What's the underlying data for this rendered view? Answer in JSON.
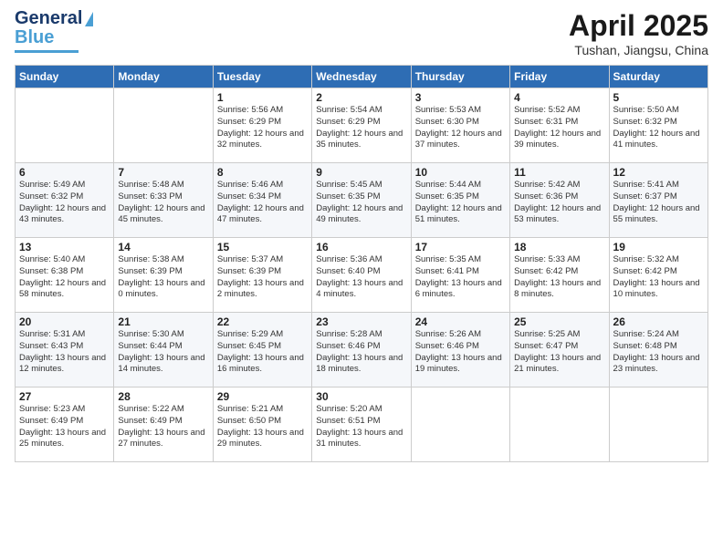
{
  "logo": {
    "line1": "General",
    "line2": "Blue"
  },
  "header": {
    "title": "April 2025",
    "subtitle": "Tushan, Jiangsu, China"
  },
  "weekdays": [
    "Sunday",
    "Monday",
    "Tuesday",
    "Wednesday",
    "Thursday",
    "Friday",
    "Saturday"
  ],
  "weeks": [
    [
      {
        "day": "",
        "sunrise": "",
        "sunset": "",
        "daylight": ""
      },
      {
        "day": "",
        "sunrise": "",
        "sunset": "",
        "daylight": ""
      },
      {
        "day": "1",
        "sunrise": "Sunrise: 5:56 AM",
        "sunset": "Sunset: 6:29 PM",
        "daylight": "Daylight: 12 hours and 32 minutes."
      },
      {
        "day": "2",
        "sunrise": "Sunrise: 5:54 AM",
        "sunset": "Sunset: 6:29 PM",
        "daylight": "Daylight: 12 hours and 35 minutes."
      },
      {
        "day": "3",
        "sunrise": "Sunrise: 5:53 AM",
        "sunset": "Sunset: 6:30 PM",
        "daylight": "Daylight: 12 hours and 37 minutes."
      },
      {
        "day": "4",
        "sunrise": "Sunrise: 5:52 AM",
        "sunset": "Sunset: 6:31 PM",
        "daylight": "Daylight: 12 hours and 39 minutes."
      },
      {
        "day": "5",
        "sunrise": "Sunrise: 5:50 AM",
        "sunset": "Sunset: 6:32 PM",
        "daylight": "Daylight: 12 hours and 41 minutes."
      }
    ],
    [
      {
        "day": "6",
        "sunrise": "Sunrise: 5:49 AM",
        "sunset": "Sunset: 6:32 PM",
        "daylight": "Daylight: 12 hours and 43 minutes."
      },
      {
        "day": "7",
        "sunrise": "Sunrise: 5:48 AM",
        "sunset": "Sunset: 6:33 PM",
        "daylight": "Daylight: 12 hours and 45 minutes."
      },
      {
        "day": "8",
        "sunrise": "Sunrise: 5:46 AM",
        "sunset": "Sunset: 6:34 PM",
        "daylight": "Daylight: 12 hours and 47 minutes."
      },
      {
        "day": "9",
        "sunrise": "Sunrise: 5:45 AM",
        "sunset": "Sunset: 6:35 PM",
        "daylight": "Daylight: 12 hours and 49 minutes."
      },
      {
        "day": "10",
        "sunrise": "Sunrise: 5:44 AM",
        "sunset": "Sunset: 6:35 PM",
        "daylight": "Daylight: 12 hours and 51 minutes."
      },
      {
        "day": "11",
        "sunrise": "Sunrise: 5:42 AM",
        "sunset": "Sunset: 6:36 PM",
        "daylight": "Daylight: 12 hours and 53 minutes."
      },
      {
        "day": "12",
        "sunrise": "Sunrise: 5:41 AM",
        "sunset": "Sunset: 6:37 PM",
        "daylight": "Daylight: 12 hours and 55 minutes."
      }
    ],
    [
      {
        "day": "13",
        "sunrise": "Sunrise: 5:40 AM",
        "sunset": "Sunset: 6:38 PM",
        "daylight": "Daylight: 12 hours and 58 minutes."
      },
      {
        "day": "14",
        "sunrise": "Sunrise: 5:38 AM",
        "sunset": "Sunset: 6:39 PM",
        "daylight": "Daylight: 13 hours and 0 minutes."
      },
      {
        "day": "15",
        "sunrise": "Sunrise: 5:37 AM",
        "sunset": "Sunset: 6:39 PM",
        "daylight": "Daylight: 13 hours and 2 minutes."
      },
      {
        "day": "16",
        "sunrise": "Sunrise: 5:36 AM",
        "sunset": "Sunset: 6:40 PM",
        "daylight": "Daylight: 13 hours and 4 minutes."
      },
      {
        "day": "17",
        "sunrise": "Sunrise: 5:35 AM",
        "sunset": "Sunset: 6:41 PM",
        "daylight": "Daylight: 13 hours and 6 minutes."
      },
      {
        "day": "18",
        "sunrise": "Sunrise: 5:33 AM",
        "sunset": "Sunset: 6:42 PM",
        "daylight": "Daylight: 13 hours and 8 minutes."
      },
      {
        "day": "19",
        "sunrise": "Sunrise: 5:32 AM",
        "sunset": "Sunset: 6:42 PM",
        "daylight": "Daylight: 13 hours and 10 minutes."
      }
    ],
    [
      {
        "day": "20",
        "sunrise": "Sunrise: 5:31 AM",
        "sunset": "Sunset: 6:43 PM",
        "daylight": "Daylight: 13 hours and 12 minutes."
      },
      {
        "day": "21",
        "sunrise": "Sunrise: 5:30 AM",
        "sunset": "Sunset: 6:44 PM",
        "daylight": "Daylight: 13 hours and 14 minutes."
      },
      {
        "day": "22",
        "sunrise": "Sunrise: 5:29 AM",
        "sunset": "Sunset: 6:45 PM",
        "daylight": "Daylight: 13 hours and 16 minutes."
      },
      {
        "day": "23",
        "sunrise": "Sunrise: 5:28 AM",
        "sunset": "Sunset: 6:46 PM",
        "daylight": "Daylight: 13 hours and 18 minutes."
      },
      {
        "day": "24",
        "sunrise": "Sunrise: 5:26 AM",
        "sunset": "Sunset: 6:46 PM",
        "daylight": "Daylight: 13 hours and 19 minutes."
      },
      {
        "day": "25",
        "sunrise": "Sunrise: 5:25 AM",
        "sunset": "Sunset: 6:47 PM",
        "daylight": "Daylight: 13 hours and 21 minutes."
      },
      {
        "day": "26",
        "sunrise": "Sunrise: 5:24 AM",
        "sunset": "Sunset: 6:48 PM",
        "daylight": "Daylight: 13 hours and 23 minutes."
      }
    ],
    [
      {
        "day": "27",
        "sunrise": "Sunrise: 5:23 AM",
        "sunset": "Sunset: 6:49 PM",
        "daylight": "Daylight: 13 hours and 25 minutes."
      },
      {
        "day": "28",
        "sunrise": "Sunrise: 5:22 AM",
        "sunset": "Sunset: 6:49 PM",
        "daylight": "Daylight: 13 hours and 27 minutes."
      },
      {
        "day": "29",
        "sunrise": "Sunrise: 5:21 AM",
        "sunset": "Sunset: 6:50 PM",
        "daylight": "Daylight: 13 hours and 29 minutes."
      },
      {
        "day": "30",
        "sunrise": "Sunrise: 5:20 AM",
        "sunset": "Sunset: 6:51 PM",
        "daylight": "Daylight: 13 hours and 31 minutes."
      },
      {
        "day": "",
        "sunrise": "",
        "sunset": "",
        "daylight": ""
      },
      {
        "day": "",
        "sunrise": "",
        "sunset": "",
        "daylight": ""
      },
      {
        "day": "",
        "sunrise": "",
        "sunset": "",
        "daylight": ""
      }
    ]
  ]
}
